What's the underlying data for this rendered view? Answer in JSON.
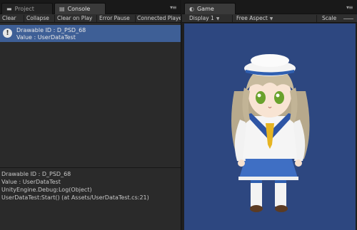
{
  "left_panel": {
    "tabs": [
      {
        "label": "Project",
        "icon": "folder-icon"
      },
      {
        "label": "Console",
        "icon": "console-icon"
      }
    ],
    "toolbar": {
      "clear": "Clear",
      "collapse": "Collapse",
      "clear_on_play": "Clear on Play",
      "error_pause": "Error Pause",
      "connected_player": "Connected Playe"
    },
    "log": {
      "line1": "Drawable ID : D_PSD_68",
      "line2": "Value : UserDataTest",
      "icon": "info-icon"
    },
    "detail": [
      "Drawable ID : D_PSD_68",
      "Value : UserDataTest",
      "UnityEngine.Debug:Log(Object)",
      "UserDataTest:Start() (at Assets/UserDataTest.cs:21)"
    ]
  },
  "right_panel": {
    "tab": {
      "label": "Game",
      "icon": "game-controller-icon"
    },
    "toolbar": {
      "display": "Display 1",
      "aspect": "Free Aspect",
      "scale": "Scale"
    },
    "colors": {
      "background": "#2d4780"
    }
  }
}
